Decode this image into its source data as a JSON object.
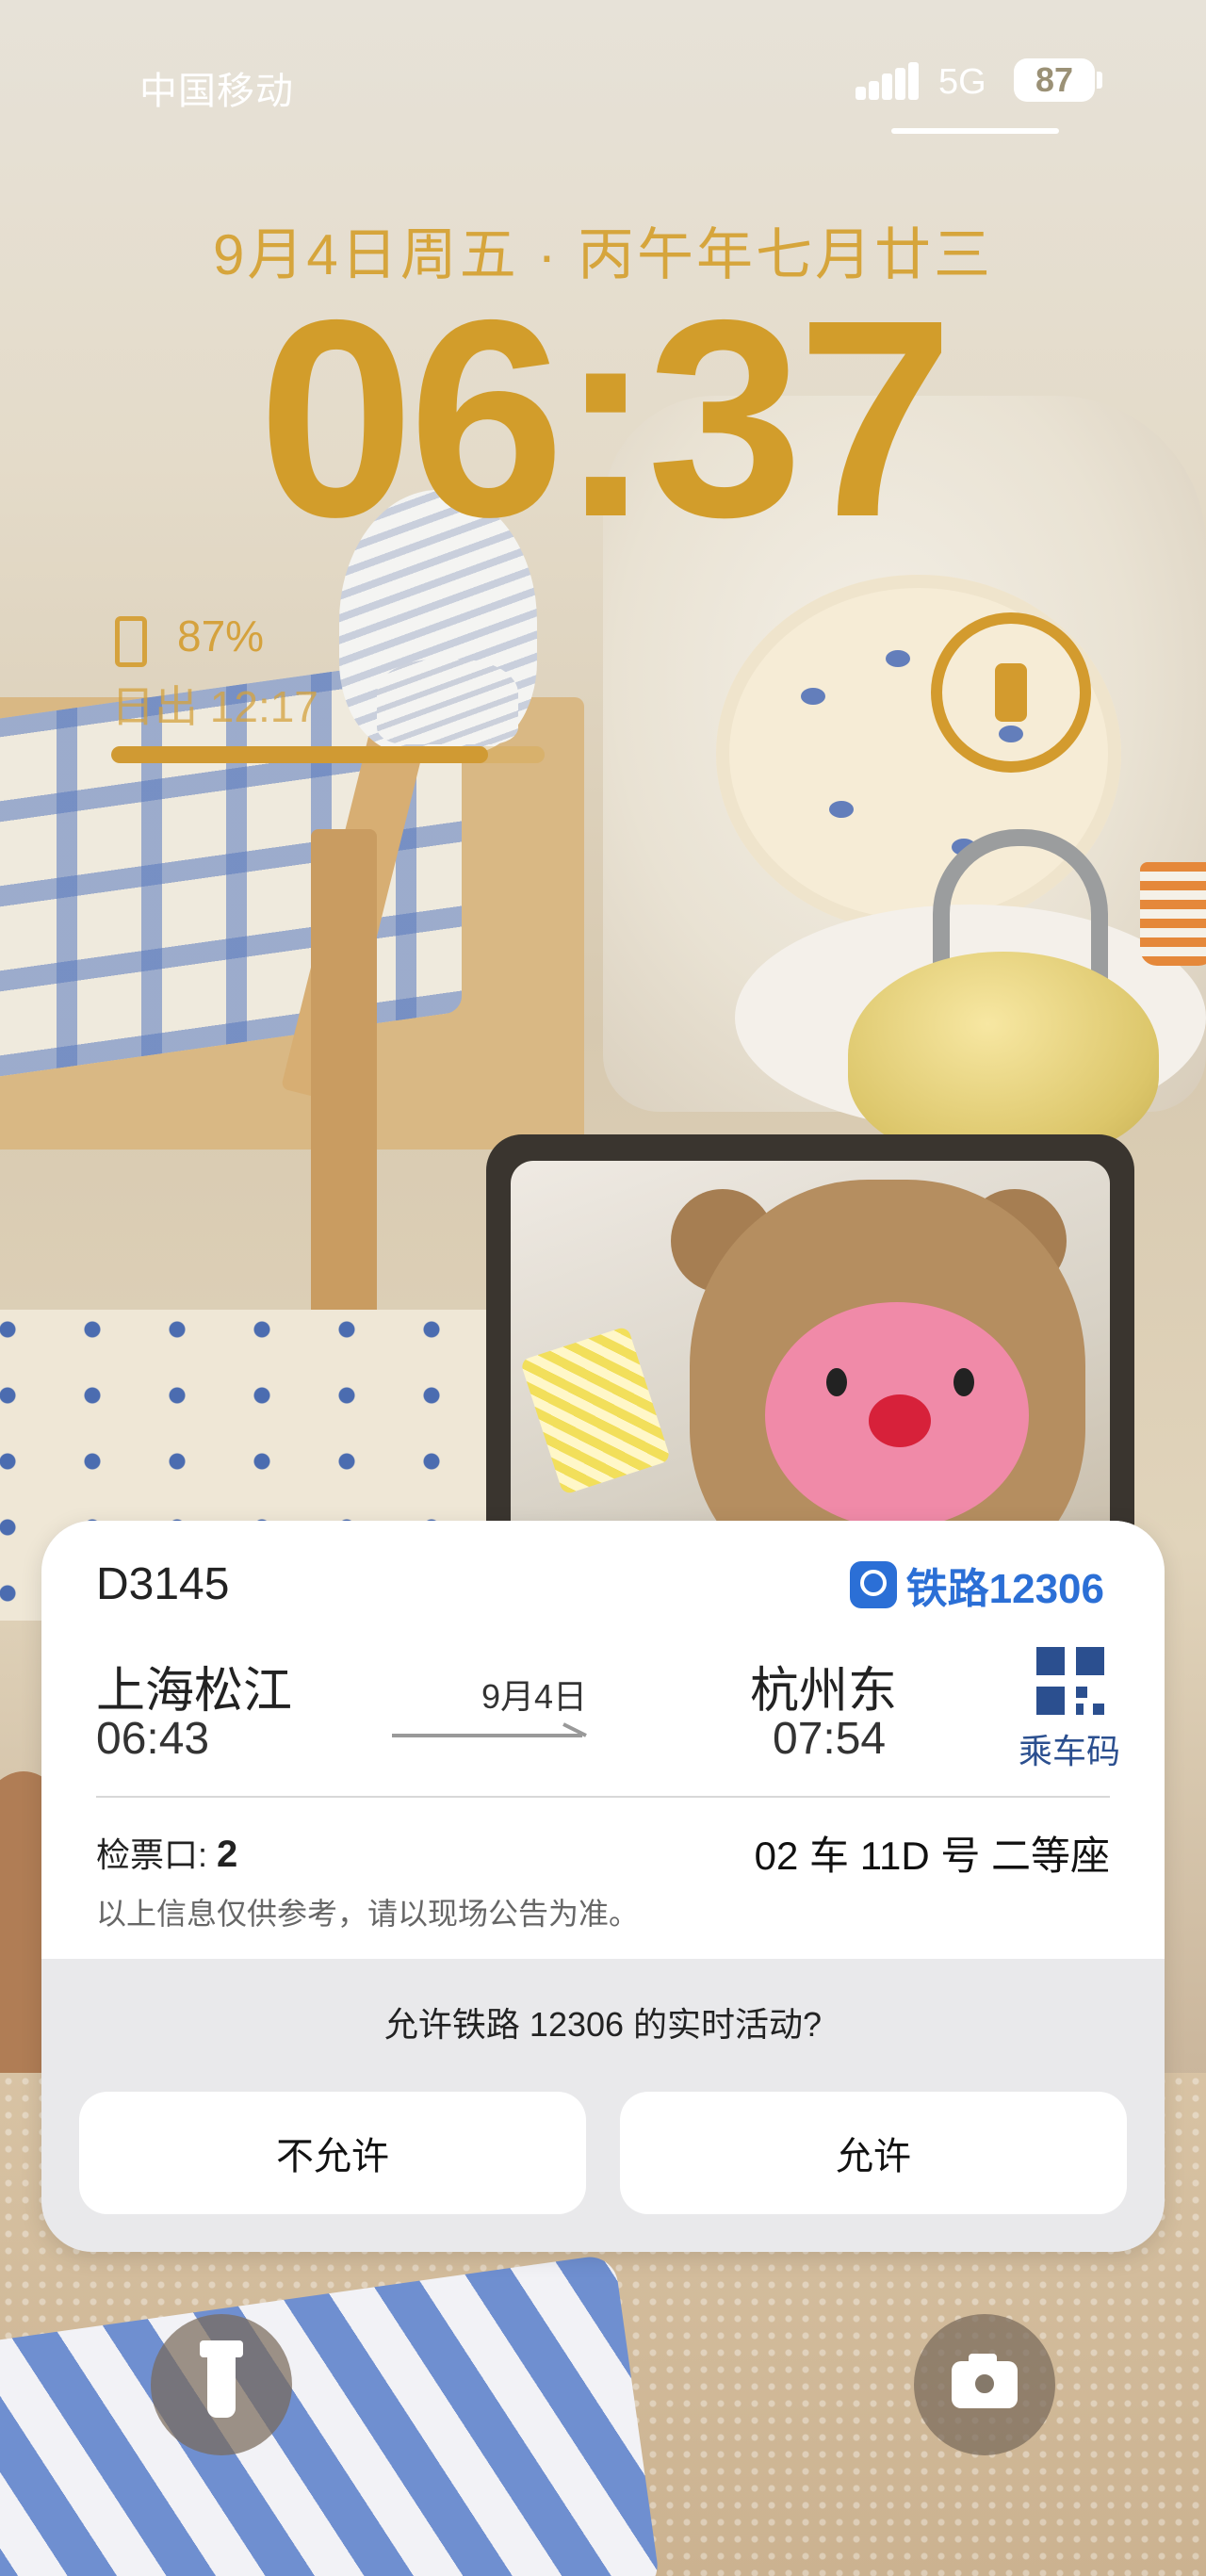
{
  "status_bar": {
    "carrier": "中国移动",
    "network": "5G",
    "battery_level": "87"
  },
  "lock_screen": {
    "date": "9月4日周五 · 丙午年七月廿三",
    "time": "06:37",
    "battery_widget": {
      "percent": "87%",
      "sunrise": "日出 12:17",
      "progress": 0.87
    },
    "ring_widget_icon": "phone-icon"
  },
  "live_activity": {
    "train_number": "D3145",
    "app_name": "铁路12306",
    "from_station": "上海松江",
    "departure_time": "06:43",
    "date": "9月4日",
    "to_station": "杭州东",
    "arrival_time": "07:54",
    "qr_label": "乘车码",
    "gate_label": "检票口:",
    "gate_number": "2",
    "seat": "02 车 11D 号 二等座",
    "disclaimer": "以上信息仅供参考，请以现场公告为准。",
    "permission_question": "允许铁路 12306 的实时活动?",
    "deny_label": "不允许",
    "allow_label": "允许"
  },
  "shortcuts": {
    "left_icon": "flashlight-icon",
    "right_icon": "camera-icon"
  },
  "colors": {
    "clock": "#d29d2b",
    "brand": "#2b6fd6",
    "qr": "#2b4f8f"
  }
}
